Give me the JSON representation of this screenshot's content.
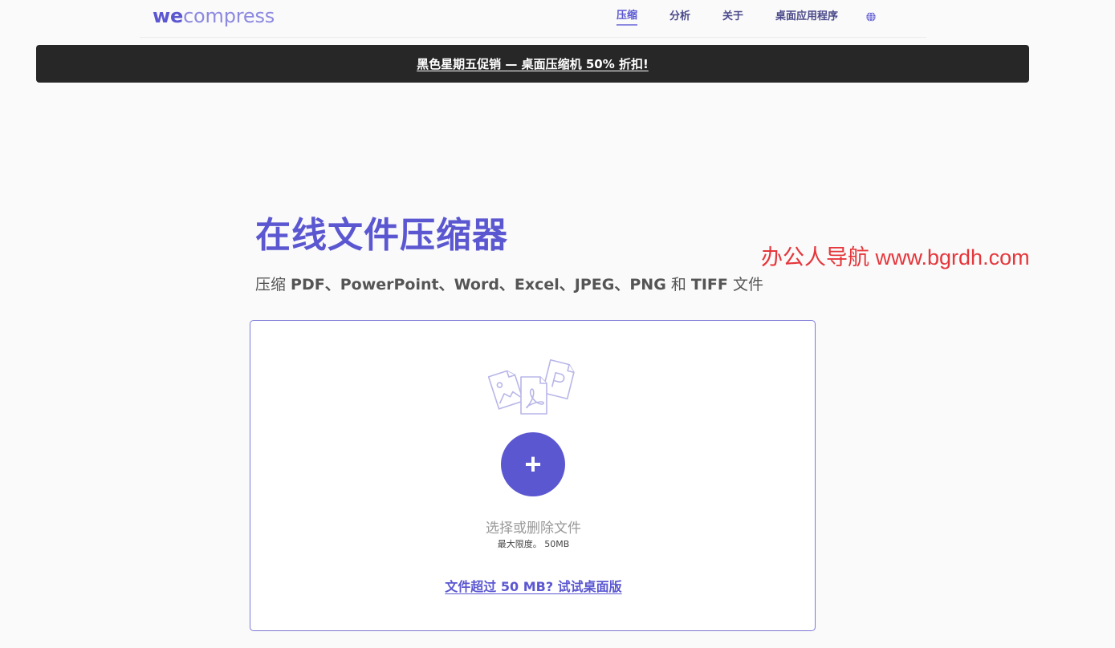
{
  "header": {
    "logo_bold": "we",
    "logo_rest": "compress",
    "nav": [
      {
        "label": "压缩",
        "active": true
      },
      {
        "label": "分析"
      },
      {
        "label": "关于"
      },
      {
        "label": "桌面应用程序"
      }
    ],
    "globe_icon": "globe-icon"
  },
  "promo": {
    "text": "黑色星期五促销 — 桌面压缩机 50% 折扣!"
  },
  "hero": {
    "title": "在线文件压缩器",
    "subtitle_parts": [
      "压缩 ",
      "PDF、PowerPoint、Word、Excel、JPEG、PNG",
      " 和 ",
      "TIFF",
      " 文件"
    ]
  },
  "watermark": "办公人导航 www.bgrdh.com",
  "upload": {
    "illustration": "documents-icon",
    "add_icon": "+",
    "select_text": "选择或删除文件",
    "limit_text": "最大限度。 50MB",
    "desktop_link": "文件超过 50 MB? 试试桌面版"
  },
  "colors": {
    "accent": "#5b57d1",
    "banner_bg": "#272727",
    "watermark": "#e5363b"
  }
}
